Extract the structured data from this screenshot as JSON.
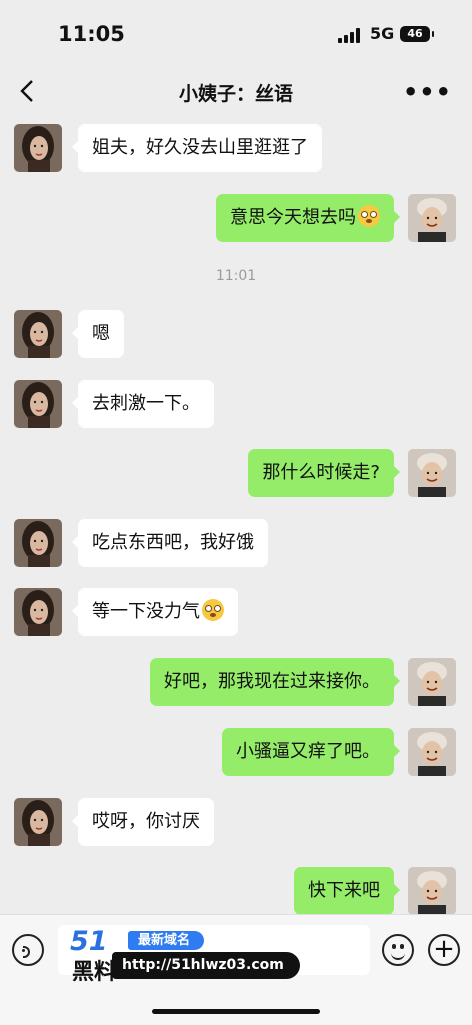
{
  "status_bar": {
    "time": "11:05",
    "network": "5G",
    "battery": "46"
  },
  "header": {
    "title": "小姨子：丝语"
  },
  "messages": [
    {
      "side": "in",
      "text": "姐夫，好久没去山里逛逛了"
    },
    {
      "side": "out",
      "text": "意思今天想去吗",
      "emoji": "flushed-face"
    },
    {
      "side": "in",
      "text": "嗯"
    },
    {
      "side": "in",
      "text": "去刺激一下。"
    },
    {
      "side": "out",
      "text": "那什么时候走?"
    },
    {
      "side": "in",
      "text": "吃点东西吧，我好饿"
    },
    {
      "side": "in",
      "text": "等一下没力气",
      "emoji": "flushed-face"
    },
    {
      "side": "out",
      "text": "好吧，那我现在过来接你。"
    },
    {
      "side": "out",
      "text": "小骚逼又痒了吧。"
    },
    {
      "side": "in",
      "text": "哎呀，你讨厌"
    },
    {
      "side": "out",
      "text": "快下来吧"
    }
  ],
  "timestamp": "11:01",
  "watermark": {
    "logo_number": "51",
    "logo_text": "黑料",
    "tag": "最新域名",
    "url": "http://51hlwz03.com"
  },
  "colors": {
    "background": "#ededed",
    "outgoing_bubble": "#95ec69",
    "incoming_bubble": "#ffffff"
  }
}
